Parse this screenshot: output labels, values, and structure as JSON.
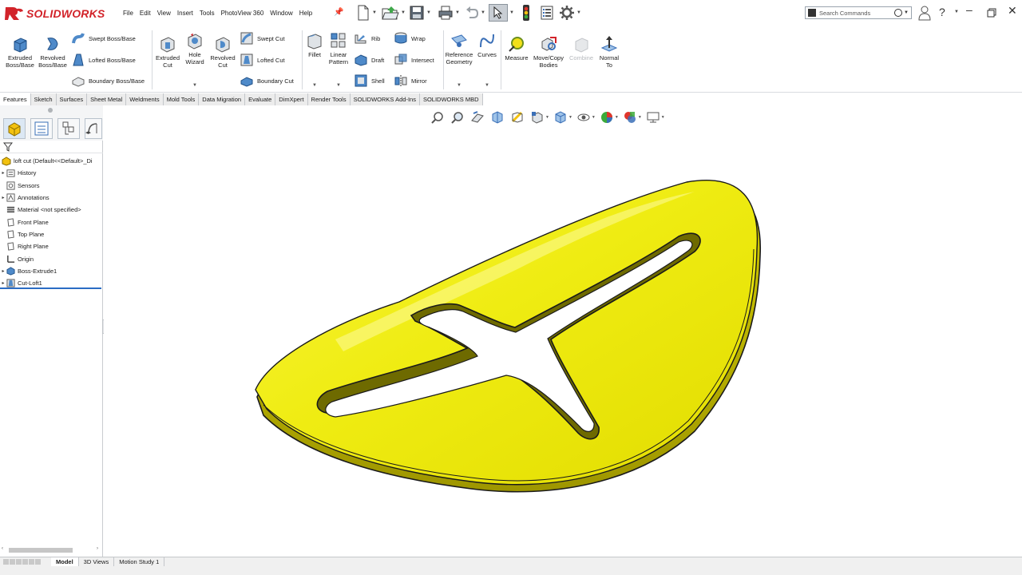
{
  "app": {
    "brand": "SOLIDWORKS",
    "menu": [
      "File",
      "Edit",
      "View",
      "Insert",
      "Tools",
      "PhotoView 360",
      "Window",
      "Help"
    ],
    "search_placeholder": "Search Commands"
  },
  "ribbon": {
    "extruded_boss": "Extruded Boss/Base",
    "revolved_boss": "Revolved Boss/Base",
    "swept_boss": "Swept Boss/Base",
    "lofted_boss": "Lofted Boss/Base",
    "boundary_boss": "Boundary Boss/Base",
    "extruded_cut": "Extruded Cut",
    "hole_wizard": "Hole Wizard",
    "revolved_cut": "Revolved Cut",
    "swept_cut": "Swept Cut",
    "lofted_cut": "Lofted Cut",
    "boundary_cut": "Boundary Cut",
    "fillet": "Fillet",
    "linear_pattern": "Linear Pattern",
    "rib": "Rib",
    "draft": "Draft",
    "shell": "Shell",
    "wrap": "Wrap",
    "intersect": "Intersect",
    "mirror": "Mirror",
    "reference_geometry": "Reference Geometry",
    "curves": "Curves",
    "measure": "Measure",
    "move_copy": "Move/Copy Bodies",
    "combine": "Combine",
    "normal_to": "Normal To"
  },
  "tabs": [
    "Features",
    "Sketch",
    "Surfaces",
    "Sheet Metal",
    "Weldments",
    "Mold Tools",
    "Data Migration",
    "Evaluate",
    "DimXpert",
    "Render Tools",
    "SOLIDWORKS Add-Ins",
    "SOLIDWORKS MBD"
  ],
  "tree": {
    "root": "loft cut  (Default<<Default>_Di",
    "items": [
      "History",
      "Sensors",
      "Annotations",
      "Material <not specified>",
      "Front Plane",
      "Top Plane",
      "Right Plane",
      "Origin",
      "Boss-Extrude1",
      "Cut-Loft1"
    ]
  },
  "bottom_tabs": [
    "Model",
    "3D Views",
    "Motion Study 1"
  ],
  "colors": {
    "part": "#f2ee0f",
    "part_shade": "#b8b000",
    "brand_red": "#d2232a",
    "selection_blue": "#2b6cc4"
  }
}
